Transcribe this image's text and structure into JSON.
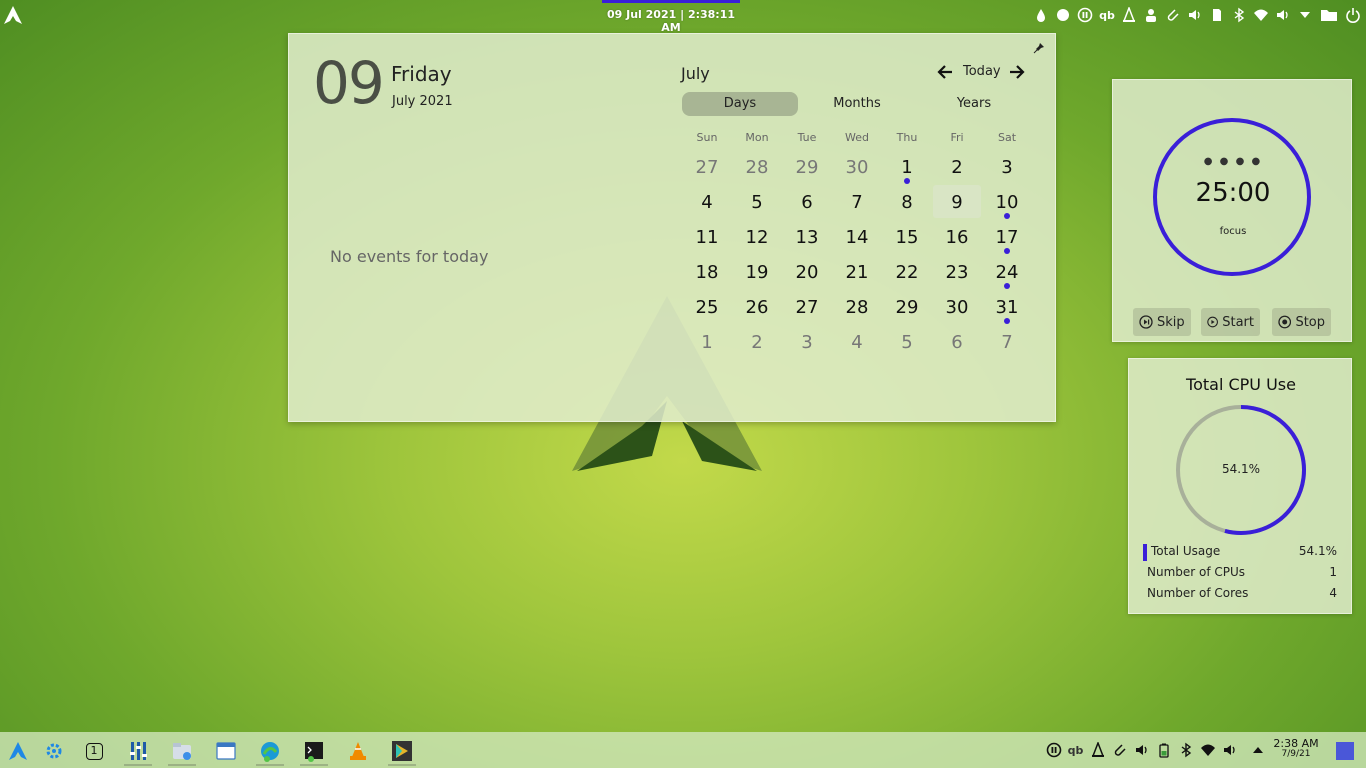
{
  "top_panel": {
    "clock": "09 Jul 2021 | 2:38:11 AM",
    "tray_icons": [
      "drop-icon",
      "circle-icon",
      "pause-circle-icon",
      "qbittorrent-icon",
      "vlc-icon",
      "user-icon",
      "paperclip-icon",
      "volume-icon",
      "sd-card-icon",
      "bluetooth-icon",
      "wifi-icon",
      "volume-icon",
      "chevron-down-icon",
      "folder-icon",
      "power-icon"
    ],
    "qb_label": "qb"
  },
  "calendar": {
    "day_number": "09",
    "weekday": "Friday",
    "month_year": "July 2021",
    "no_events": "No events for today",
    "month": "July",
    "today_label": "Today",
    "tabs": [
      "Days",
      "Months",
      "Years"
    ],
    "weekdays": [
      "Sun",
      "Mon",
      "Tue",
      "Wed",
      "Thu",
      "Fri",
      "Sat"
    ],
    "weeks": [
      [
        {
          "d": "27",
          "other": true
        },
        {
          "d": "28",
          "other": true
        },
        {
          "d": "29",
          "other": true
        },
        {
          "d": "30",
          "other": true
        },
        {
          "d": "1",
          "event": true
        },
        {
          "d": "2"
        },
        {
          "d": "3"
        }
      ],
      [
        {
          "d": "4"
        },
        {
          "d": "5"
        },
        {
          "d": "6"
        },
        {
          "d": "7"
        },
        {
          "d": "8"
        },
        {
          "d": "9",
          "selected": true
        },
        {
          "d": "10",
          "event": true
        }
      ],
      [
        {
          "d": "11"
        },
        {
          "d": "12"
        },
        {
          "d": "13"
        },
        {
          "d": "14"
        },
        {
          "d": "15"
        },
        {
          "d": "16"
        },
        {
          "d": "17",
          "event": true
        }
      ],
      [
        {
          "d": "18"
        },
        {
          "d": "19"
        },
        {
          "d": "20"
        },
        {
          "d": "21"
        },
        {
          "d": "22"
        },
        {
          "d": "23"
        },
        {
          "d": "24",
          "event": true
        }
      ],
      [
        {
          "d": "25"
        },
        {
          "d": "26"
        },
        {
          "d": "27"
        },
        {
          "d": "28"
        },
        {
          "d": "29"
        },
        {
          "d": "30"
        },
        {
          "d": "31",
          "event": true
        }
      ],
      [
        {
          "d": "1",
          "other": true
        },
        {
          "d": "2",
          "other": true
        },
        {
          "d": "3",
          "other": true
        },
        {
          "d": "4",
          "other": true
        },
        {
          "d": "5",
          "other": true
        },
        {
          "d": "6",
          "other": true
        },
        {
          "d": "7",
          "other": true
        }
      ]
    ]
  },
  "timer": {
    "dots": "● ● ● ●",
    "time": "25:00",
    "mode": "focus",
    "skip_label": "Skip",
    "start_label": "Start",
    "stop_label": "Stop",
    "ring_color": "#3a1fd8"
  },
  "cpu": {
    "title": "Total CPU Use",
    "usage_percent": 54.1,
    "center_label": "54.1%",
    "rows": [
      {
        "label": "Total Usage",
        "value": "54.1%"
      },
      {
        "label": "Number of CPUs",
        "value": "1"
      },
      {
        "label": "Number of Cores",
        "value": "4"
      }
    ],
    "accent": "#3a1fd8",
    "track": "#a8b09a"
  },
  "taskbar": {
    "apps": [
      "arch-logo-icon",
      "kde-icon",
      "virtual-desktop-icon",
      "mixer-icon",
      "file-manager-icon",
      "window-icon",
      "edge-browser-icon",
      "terminal-icon",
      "vlc-icon",
      "play-store-icon"
    ],
    "desktop_number": "1",
    "qb_label": "qb",
    "time": "2:38 AM",
    "date": "7/9/21"
  }
}
